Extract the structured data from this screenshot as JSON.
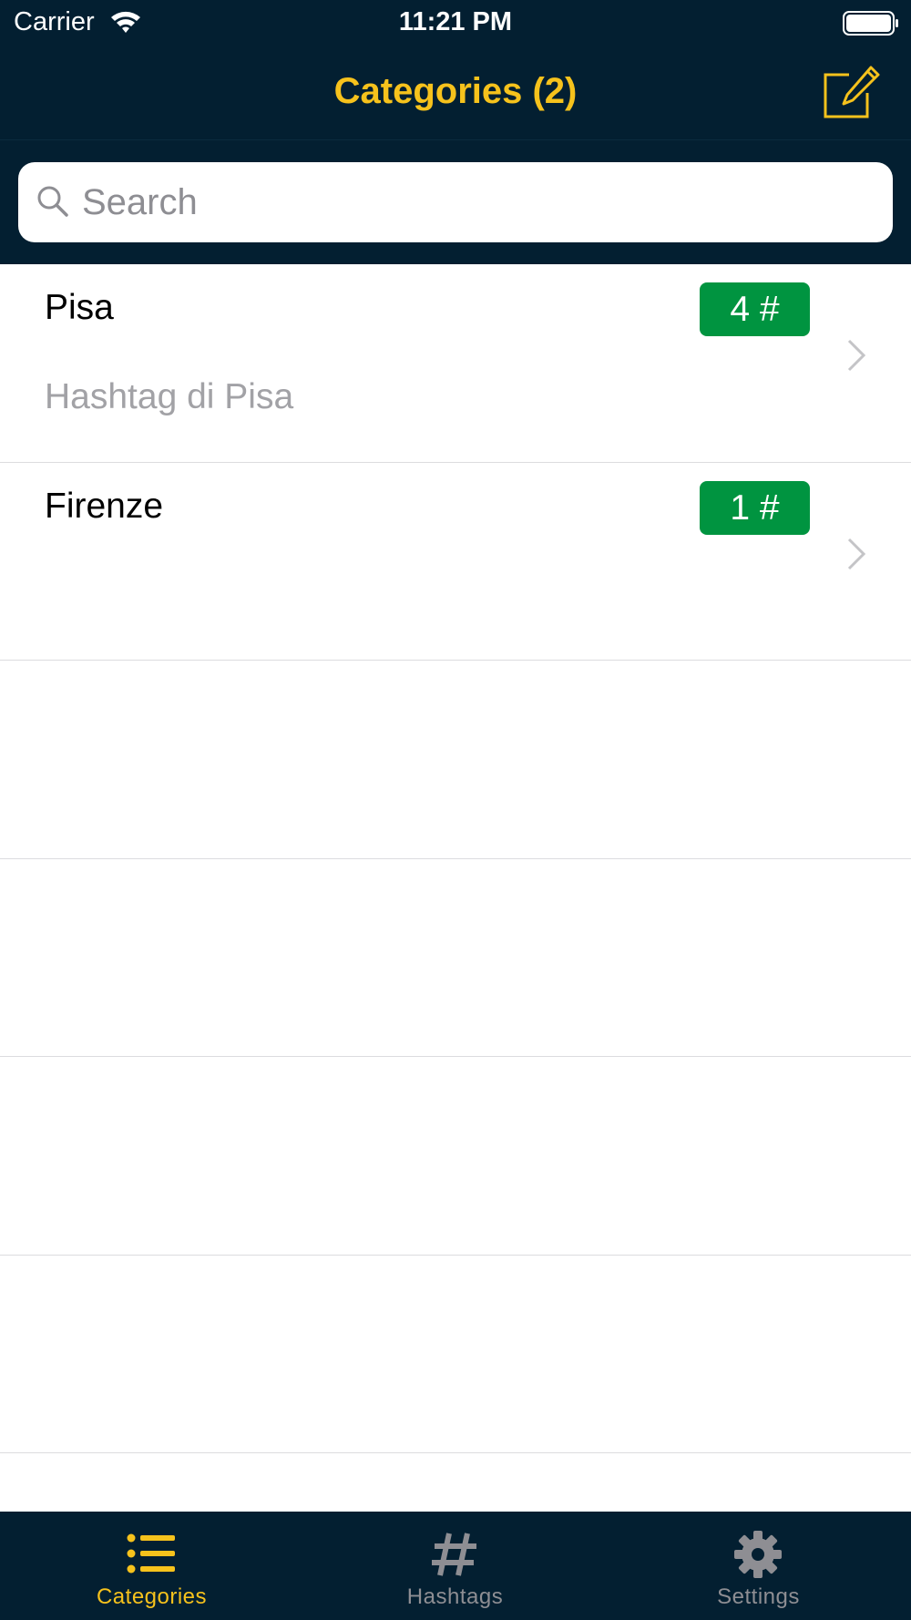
{
  "status_bar": {
    "carrier": "Carrier",
    "time": "11:21 PM"
  },
  "nav": {
    "title": "Categories (2)"
  },
  "search": {
    "placeholder": "Search"
  },
  "categories": [
    {
      "name": "Pisa",
      "count": "4 #",
      "description": "Hashtag di Pisa"
    },
    {
      "name": "Firenze",
      "count": "1 #",
      "description": ""
    }
  ],
  "tabs": [
    {
      "label": "Categories",
      "icon": "list-icon",
      "active": true
    },
    {
      "label": "Hashtags",
      "icon": "hashtag-icon",
      "active": false
    },
    {
      "label": "Settings",
      "icon": "gear-icon",
      "active": false
    }
  ],
  "colors": {
    "bar_background": "#031f31",
    "accent": "#f6c21c",
    "badge": "#009440",
    "inactive_tab": "#8e8e93"
  }
}
